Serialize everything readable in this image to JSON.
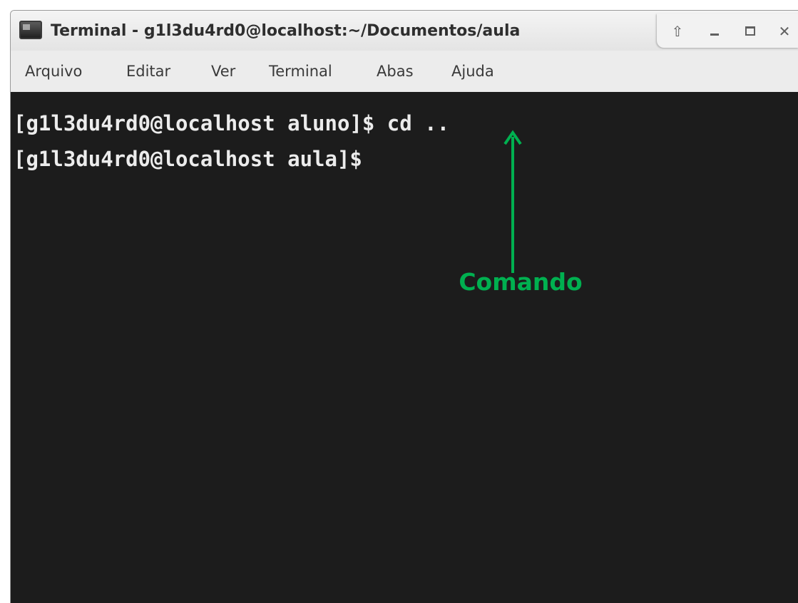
{
  "window": {
    "title": "Terminal - g1l3du4rd0@localhost:~/Documentos/aula"
  },
  "titlebar_icons": {
    "app": "terminal-icon",
    "up": "arrow-up-icon",
    "minimize": "minimize-icon",
    "maximize": "maximize-icon",
    "close": "close-icon"
  },
  "menu": {
    "items": [
      "Arquivo",
      "Editar",
      "Ver",
      "Terminal",
      "Abas",
      "Ajuda"
    ]
  },
  "terminal": {
    "lines": [
      "[g1l3du4rd0@localhost aluno]$ cd ..",
      "[g1l3du4rd0@localhost aula]$"
    ]
  },
  "annotation": {
    "label": "Comando",
    "color": "#00b050"
  },
  "colors": {
    "terminal_bg": "#1c1c1c",
    "terminal_fg": "#ececec"
  }
}
